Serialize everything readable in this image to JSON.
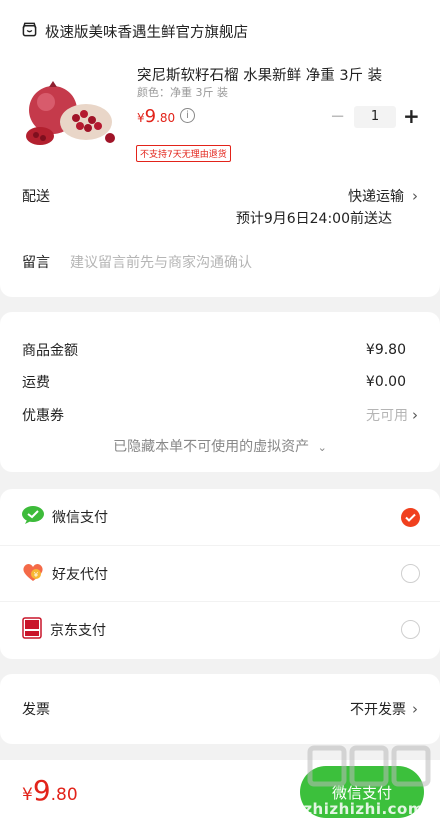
{
  "store": {
    "name": "极速版美味香遇生鲜官方旗舰店",
    "icon": "store-icon"
  },
  "product": {
    "title": "突尼斯软籽石榴 水果新鲜 净重 3斤 装",
    "spec": "颜色：净重 3斤 装",
    "currency": "¥",
    "price_int": "9",
    "price_dec": ".80",
    "quantity": "1",
    "minus": "−",
    "plus": "+",
    "tag": "不支持7天无理由退货"
  },
  "delivery": {
    "label": "配送",
    "method": "快递运输",
    "eta": "预计9月6日24:00前送达"
  },
  "remark": {
    "label": "留言",
    "placeholder": "建议留言前先与商家沟通确认"
  },
  "summary": {
    "goods_label": "商品金额",
    "goods_value": "¥9.80",
    "shipping_label": "运费",
    "shipping_value": "¥0.00",
    "coupon_label": "优惠券",
    "coupon_value": "无可用",
    "hidden_note": "已隐藏本单不可使用的虚拟资产"
  },
  "payment": {
    "methods": [
      {
        "label": "微信支付",
        "icon": "wechat-pay-icon",
        "selected": true
      },
      {
        "label": "好友代付",
        "icon": "friend-pay-icon",
        "selected": false
      },
      {
        "label": "京东支付",
        "icon": "jd-pay-icon",
        "selected": false
      }
    ]
  },
  "invoice": {
    "label": "发票",
    "value": "不开发票"
  },
  "footer": {
    "currency": "¥",
    "total_int": "9",
    "total_dec": ".80",
    "pay_button": "微信支付"
  },
  "watermark": {
    "text": "值得买",
    "url": "zhizhizhi.com"
  },
  "colors": {
    "accent": "#e2231a",
    "wechat_green": "#3dbb3a",
    "radio_on": "#f0401e",
    "background": "#f2f2f2"
  }
}
